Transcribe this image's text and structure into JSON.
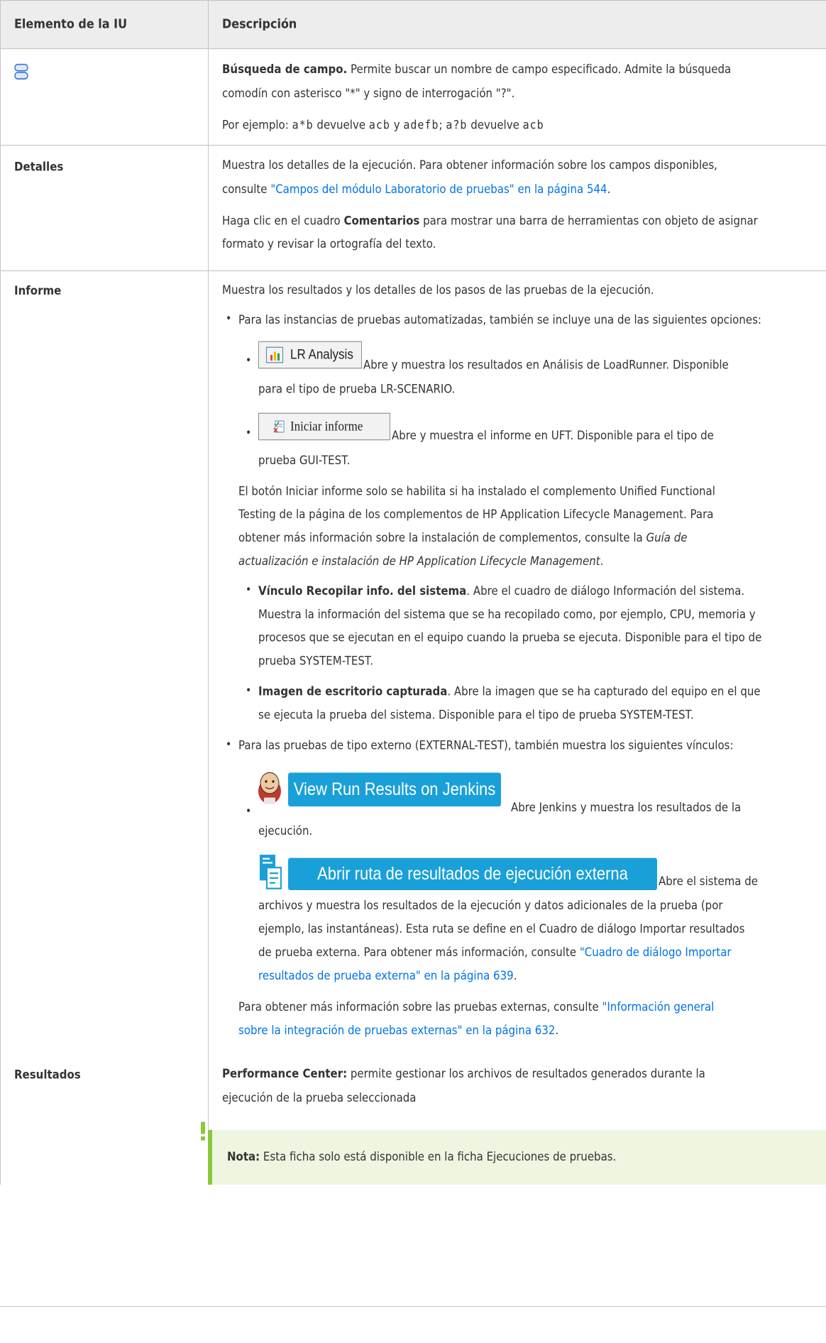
{
  "header": {
    "col1": "Elemento de la IU",
    "col2": "Descripción"
  },
  "row1": {
    "icon": "field-search-icon",
    "title": "Búsqueda de campo.",
    "text1": " Permite buscar un nombre de campo especificado. Admite la búsqueda",
    "text2": "comodín con asterisco \"*\" y signo de interrogación \"?\".",
    "ex_pre": "Por ejemplo: ",
    "ex_a": "a*b",
    "ex_mid1": " devuelve ",
    "ex_b": "acb",
    "ex_y": " y ",
    "ex_c": "adefb",
    "ex_sep": "; ",
    "ex_d": "a?b",
    "ex_mid2": " devuelve ",
    "ex_e": "acb"
  },
  "row2": {
    "name": "Detalles",
    "l1": "Muestra los detalles de la ejecución. Para obtener información sobre los campos disponibles,",
    "l2_pre": "consulte ",
    "l2_link": "\"Campos del módulo Laboratorio de pruebas\" en la página 544",
    "l2_post": ".",
    "l3_pre": "Haga clic en el cuadro ",
    "l3_bold": "Comentarios",
    "l3_post": " para mostrar una barra de herramientas con objeto de asignar",
    "l4": "formato y revisar la ortografía del texto."
  },
  "row3": {
    "name": "Informe",
    "l1": "Muestra los resultados y los detalles de los pasos de las pruebas de la ejecución.",
    "b1": "Para las instancias de pruebas automatizadas, también se incluye una de las siguientes opciones:",
    "lr_btn": "LR Analysis",
    "lr_t1": "Abre y muestra los resultados en Análisis de LoadRunner. Disponible",
    "lr_t2": "para el tipo de prueba LR-SCENARIO.",
    "ini_btn": "Iniciar informe",
    "ini_t1": "Abre y muestra el informe en UFT. Disponible para el tipo de",
    "ini_t2": "prueba GUI-TEST.",
    "p1": "El botón Iniciar informe solo se habilita si ha instalado el complemento Unified Functional",
    "p2": "Testing de la página de los complementos de HP Application Lifecycle Management. Para",
    "p3_pre": "obtener más información sobre la instalación de complementos, consulte la ",
    "p3_it": "Guía de",
    "p4_it": "actualización e instalación de HP Application Lifecycle Management",
    "p4_post": ".",
    "v_bold": "Vínculo Recopilar info. del sistema",
    "v1": ". Abre el cuadro de diálogo Información del sistema.",
    "v2": "Muestra la información del sistema que se ha recopilado como, por ejemplo, CPU, memoria y",
    "v3": "procesos que se ejecutan en el equipo cuando la prueba se ejecuta. Disponible para el tipo de",
    "v4": "prueba SYSTEM-TEST.",
    "img_bold": "Imagen de escritorio capturada",
    "img1": ". Abre la imagen que se ha capturado del equipo en el que",
    "img2": "se ejecuta la prueba del sistema. Disponible para el tipo de prueba SYSTEM-TEST.",
    "b2": "Para las pruebas de tipo externo (EXTERNAL-TEST), también muestra los siguientes vínculos:",
    "jenkins_btn": "View Run Results on Jenkins",
    "jenkins_t1": "Abre Jenkins y muestra los resultados de la",
    "jenkins_t2": "ejecución.",
    "ext_btn": "Abrir ruta de resultados de ejecución externa",
    "ext_t1": "Abre el sistema de",
    "ext_t2": "archivos y muestra los resultados de la ejecución y datos adicionales de la prueba (por",
    "ext_t3": "ejemplo, las instantáneas). Esta ruta se define en el Cuadro de diálogo Importar resultados",
    "ext_t4_pre": "de prueba externa. Para obtener más información, consulte ",
    "ext_t4_link": "\"Cuadro de diálogo Importar",
    "ext_t5_link": "resultados de prueba externa\" en la página 639",
    "ext_t5_post": ".",
    "f1_pre": "Para obtener más información sobre las pruebas externas, consulte ",
    "f1_link": "\"Información general",
    "f2_link": "sobre la integración de pruebas externas\" en la página 632",
    "f2_post": "."
  },
  "row4": {
    "name": "Resultados",
    "bold": "Performance Center:",
    "t1": " permite gestionar los archivos de resultados generados durante la",
    "t2": "ejecución de la prueba seleccionada",
    "note_bold": "Nota:",
    "note_text": " Esta ficha solo está disponible en la ficha Ejecuciones de pruebas."
  },
  "colors": {
    "link": "#0073e7",
    "header_bg": "#ededed",
    "button_blue": "#1aa0d8",
    "note_bg": "#eef5e1",
    "note_bar": "#8dc63f"
  }
}
